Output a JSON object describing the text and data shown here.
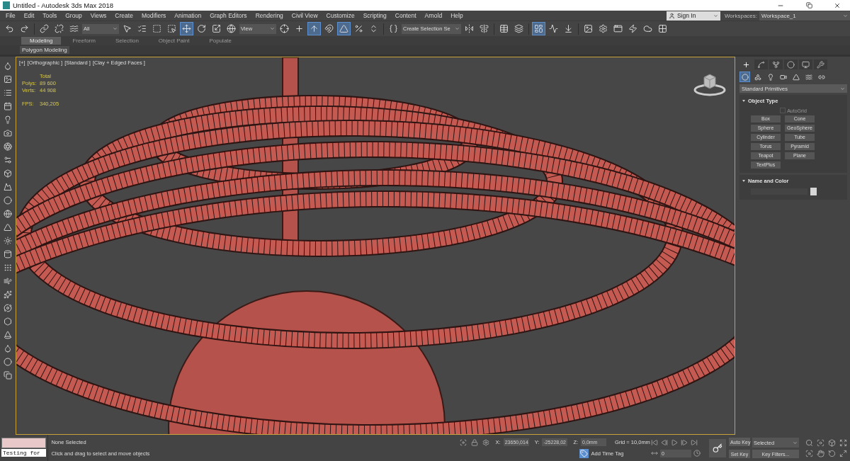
{
  "window": {
    "title": "Untitled - Autodesk 3ds Max 2018"
  },
  "menu": [
    "File",
    "Edit",
    "Tools",
    "Group",
    "Views",
    "Create",
    "Modifiers",
    "Animation",
    "Graph Editors",
    "Rendering",
    "Civil View",
    "Customize",
    "Scripting",
    "Content",
    "Arnold",
    "Help"
  ],
  "account": {
    "label": "Sign In"
  },
  "workspaces": {
    "label": "Workspaces:",
    "value": "Workspace_1"
  },
  "main_toolbar": [
    {
      "kind": "icon",
      "selected": false
    },
    {
      "kind": "icon",
      "selected": false
    },
    {
      "kind": "separator"
    },
    {
      "kind": "icon",
      "selected": false
    },
    {
      "kind": "icon",
      "selected": false
    },
    {
      "kind": "icon",
      "selected": false
    },
    {
      "kind": "dropdown",
      "value": "All"
    },
    {
      "kind": "icon",
      "selected": false
    },
    {
      "kind": "icon",
      "selected": false
    },
    {
      "kind": "icon",
      "selected": false
    },
    {
      "kind": "icon",
      "selected": false
    },
    {
      "kind": "icon",
      "selected": true
    },
    {
      "kind": "icon",
      "selected": false
    },
    {
      "kind": "icon",
      "selected": false
    },
    {
      "kind": "icon",
      "selected": false
    },
    {
      "kind": "dropdown",
      "value": "View"
    },
    {
      "kind": "icon",
      "selected": false
    },
    {
      "kind": "icon",
      "selected": false
    },
    {
      "kind": "icon",
      "selected": true
    },
    {
      "kind": "icon",
      "selected": false
    },
    {
      "kind": "icon",
      "selected": true
    },
    {
      "kind": "icon",
      "selected": false
    },
    {
      "kind": "icon",
      "selected": false
    },
    {
      "kind": "separator"
    },
    {
      "kind": "icon",
      "selected": false
    },
    {
      "kind": "field",
      "value": "Create Selection Se"
    },
    {
      "kind": "icon",
      "selected": false
    },
    {
      "kind": "icon",
      "selected": false
    },
    {
      "kind": "separator"
    },
    {
      "kind": "icon",
      "selected": false
    },
    {
      "kind": "icon",
      "selected": false
    },
    {
      "kind": "separator"
    },
    {
      "kind": "icon",
      "selected": true
    },
    {
      "kind": "icon",
      "selected": false
    },
    {
      "kind": "icon",
      "selected": false
    },
    {
      "kind": "separator"
    },
    {
      "kind": "icon",
      "selected": false
    },
    {
      "kind": "icon",
      "selected": false
    },
    {
      "kind": "icon",
      "selected": false
    },
    {
      "kind": "icon",
      "selected": false
    },
    {
      "kind": "icon",
      "selected": false
    },
    {
      "kind": "icon",
      "selected": false
    }
  ],
  "ribbon": {
    "tabs": [
      {
        "label": "Modeling",
        "selected": true
      },
      {
        "label": "Freeform",
        "selected": false
      },
      {
        "label": "Selection",
        "selected": false
      },
      {
        "label": "Object Paint",
        "selected": false
      },
      {
        "label": "Populate",
        "selected": false
      }
    ],
    "panel": "Polygon Modeling"
  },
  "viewport": {
    "labels": [
      "[+]",
      "[Orthographic ]",
      "[Standard ]",
      "[Clay + Edged Faces ]"
    ],
    "stats": {
      "header": "Total",
      "rows": [
        {
          "label": "Polys:",
          "value": "89 600"
        },
        {
          "label": "Verts:",
          "value": "44 908"
        }
      ],
      "fps_label": "FPS:",
      "fps": "340,205"
    }
  },
  "command_panel": {
    "tabs": [
      {
        "selected": true
      },
      {
        "selected": false
      },
      {
        "selected": false
      },
      {
        "selected": false
      },
      {
        "selected": false
      },
      {
        "selected": false
      }
    ],
    "categories": [
      {
        "selected": true
      },
      {
        "selected": false
      },
      {
        "selected": false
      },
      {
        "selected": false
      },
      {
        "selected": false
      },
      {
        "selected": false
      },
      {
        "selected": false
      }
    ],
    "dropdown": "Standard Primitives",
    "rollouts": [
      {
        "kind": "buttons",
        "title": "Object Type",
        "expanded": true,
        "autogrid": {
          "label": "AutoGrid",
          "disabled": true
        },
        "buttons": [
          "Box",
          "Cone",
          "Sphere",
          "GeoSphere",
          "Cylinder",
          "Tube",
          "Torus",
          "Pyramid",
          "Teapot",
          "Plane",
          "TextPlus"
        ]
      },
      {
        "kind": "name_color",
        "title": "Name and Color",
        "expanded": true
      }
    ]
  },
  "status": {
    "listener": "Testing for",
    "selection": "None Selected",
    "prompt": "Click and drag to select and move objects"
  },
  "coords": [
    {
      "label": "X:",
      "value": "23650,014"
    },
    {
      "label": "Y:",
      "value": "-25228,02"
    },
    {
      "label": "Z:",
      "value": "0,0mm"
    }
  ],
  "grid": "Grid = 10,0mm",
  "time_tag": "Add Time Tag",
  "frame": "0",
  "animation": {
    "auto_key": "Auto Key",
    "key_mode": "Selected",
    "set_key": "Set Key",
    "key_filters": "Key Filters..."
  }
}
